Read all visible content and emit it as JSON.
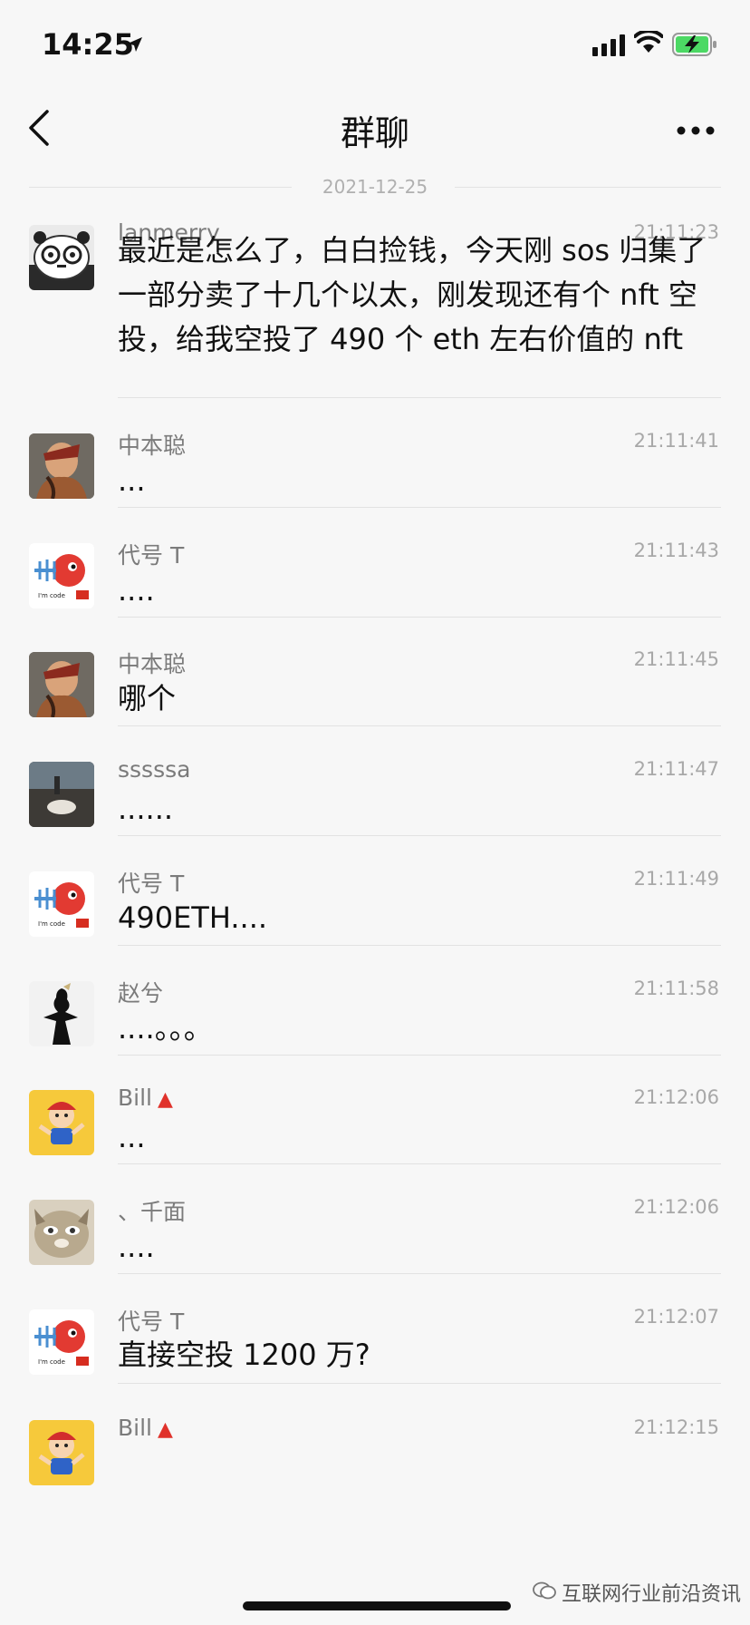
{
  "status": {
    "time": "14:25"
  },
  "header": {
    "title": "群聊"
  },
  "date_separator": "2021-12-25",
  "messages": [
    {
      "sender": "lanmerry",
      "time": "21:11:23",
      "text": "最近是怎么了，白白捡钱，今天刚 sos 归集了一部分卖了十几个以太，刚发现还有个 nft 空投，给我空投了 490 个 eth 左右价值的 nft",
      "avatar": "panda-avatar"
    },
    {
      "sender": "中本聪",
      "time": "21:11:41",
      "text": "...",
      "avatar": "warrior-avatar"
    },
    {
      "sender": "代号 T",
      "time": "21:11:43",
      "text": "....",
      "avatar": "fishbone-avatar"
    },
    {
      "sender": "中本聪",
      "time": "21:11:45",
      "text": "哪个",
      "avatar": "warrior-avatar"
    },
    {
      "sender": "sssssa",
      "time": "21:11:47",
      "text": "......",
      "avatar": "photo-avatar"
    },
    {
      "sender": "代号 T",
      "time": "21:11:49",
      "text": "490ETH....",
      "avatar": "fishbone-avatar"
    },
    {
      "sender": "赵兮",
      "time": "21:11:58",
      "text": "....。。。",
      "avatar": "silhouette-avatar"
    },
    {
      "sender": "Bill",
      "time": "21:12:06",
      "text": "...",
      "avatar": "cartoon-boy-avatar",
      "badge": "▲"
    },
    {
      "sender": "、千面",
      "time": "21:12:06",
      "text": "....",
      "avatar": "cat-avatar"
    },
    {
      "sender": "代号 T",
      "time": "21:12:07",
      "text": "直接空投 1200 万?",
      "avatar": "fishbone-avatar"
    },
    {
      "sender": "Bill",
      "time": "21:12:15",
      "text": "",
      "avatar": "cartoon-boy-avatar",
      "badge": "▲"
    }
  ],
  "avatar_caption": "I'm code",
  "watermark": "互联网行业前沿资讯",
  "colors": {
    "background": "#f7f7f7",
    "badge": "#e0322b",
    "battery": "#4cd964"
  }
}
